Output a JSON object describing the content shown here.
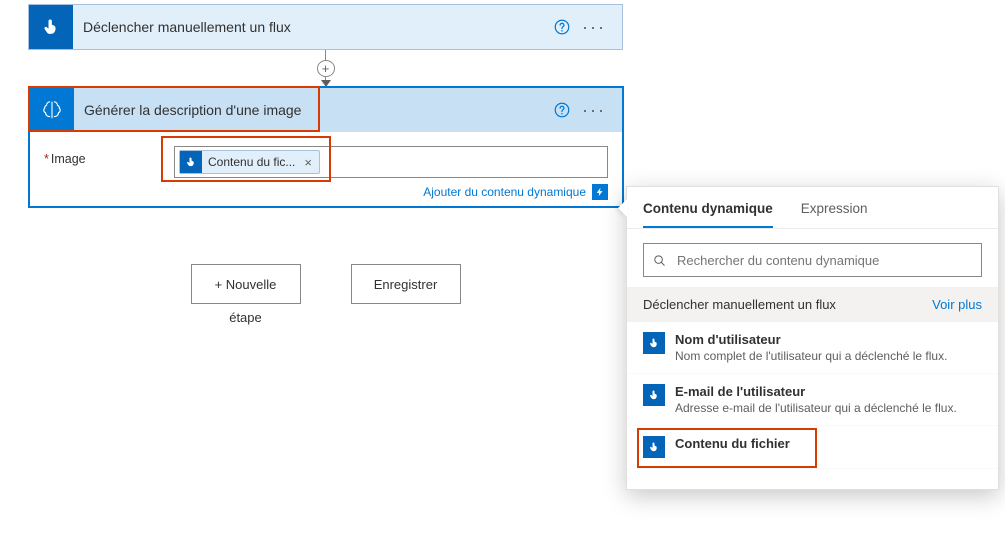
{
  "trigger": {
    "title": "Déclencher manuellement un flux"
  },
  "action": {
    "title": "Générer la description d'une image",
    "param_label": "Image",
    "token_text": "Contenu du fic...",
    "dynamic_link": "Ajouter du contenu dynamique"
  },
  "buttons": {
    "new_step_line1": "+ Nouvelle",
    "new_step_line2": "étape",
    "save": "Enregistrer"
  },
  "panel": {
    "tab_dynamic": "Contenu dynamique",
    "tab_expression": "Expression",
    "search_placeholder": "Rechercher du contenu dynamique",
    "section_title": "Déclencher manuellement un flux",
    "see_more": "Voir plus",
    "items": [
      {
        "title": "Nom d'utilisateur",
        "desc": "Nom complet de l'utilisateur qui a déclenché le flux."
      },
      {
        "title": "E-mail de l'utilisateur",
        "desc": "Adresse e-mail de l'utilisateur qui a déclenché le flux."
      },
      {
        "title": "Contenu du fichier",
        "desc": ""
      }
    ]
  }
}
